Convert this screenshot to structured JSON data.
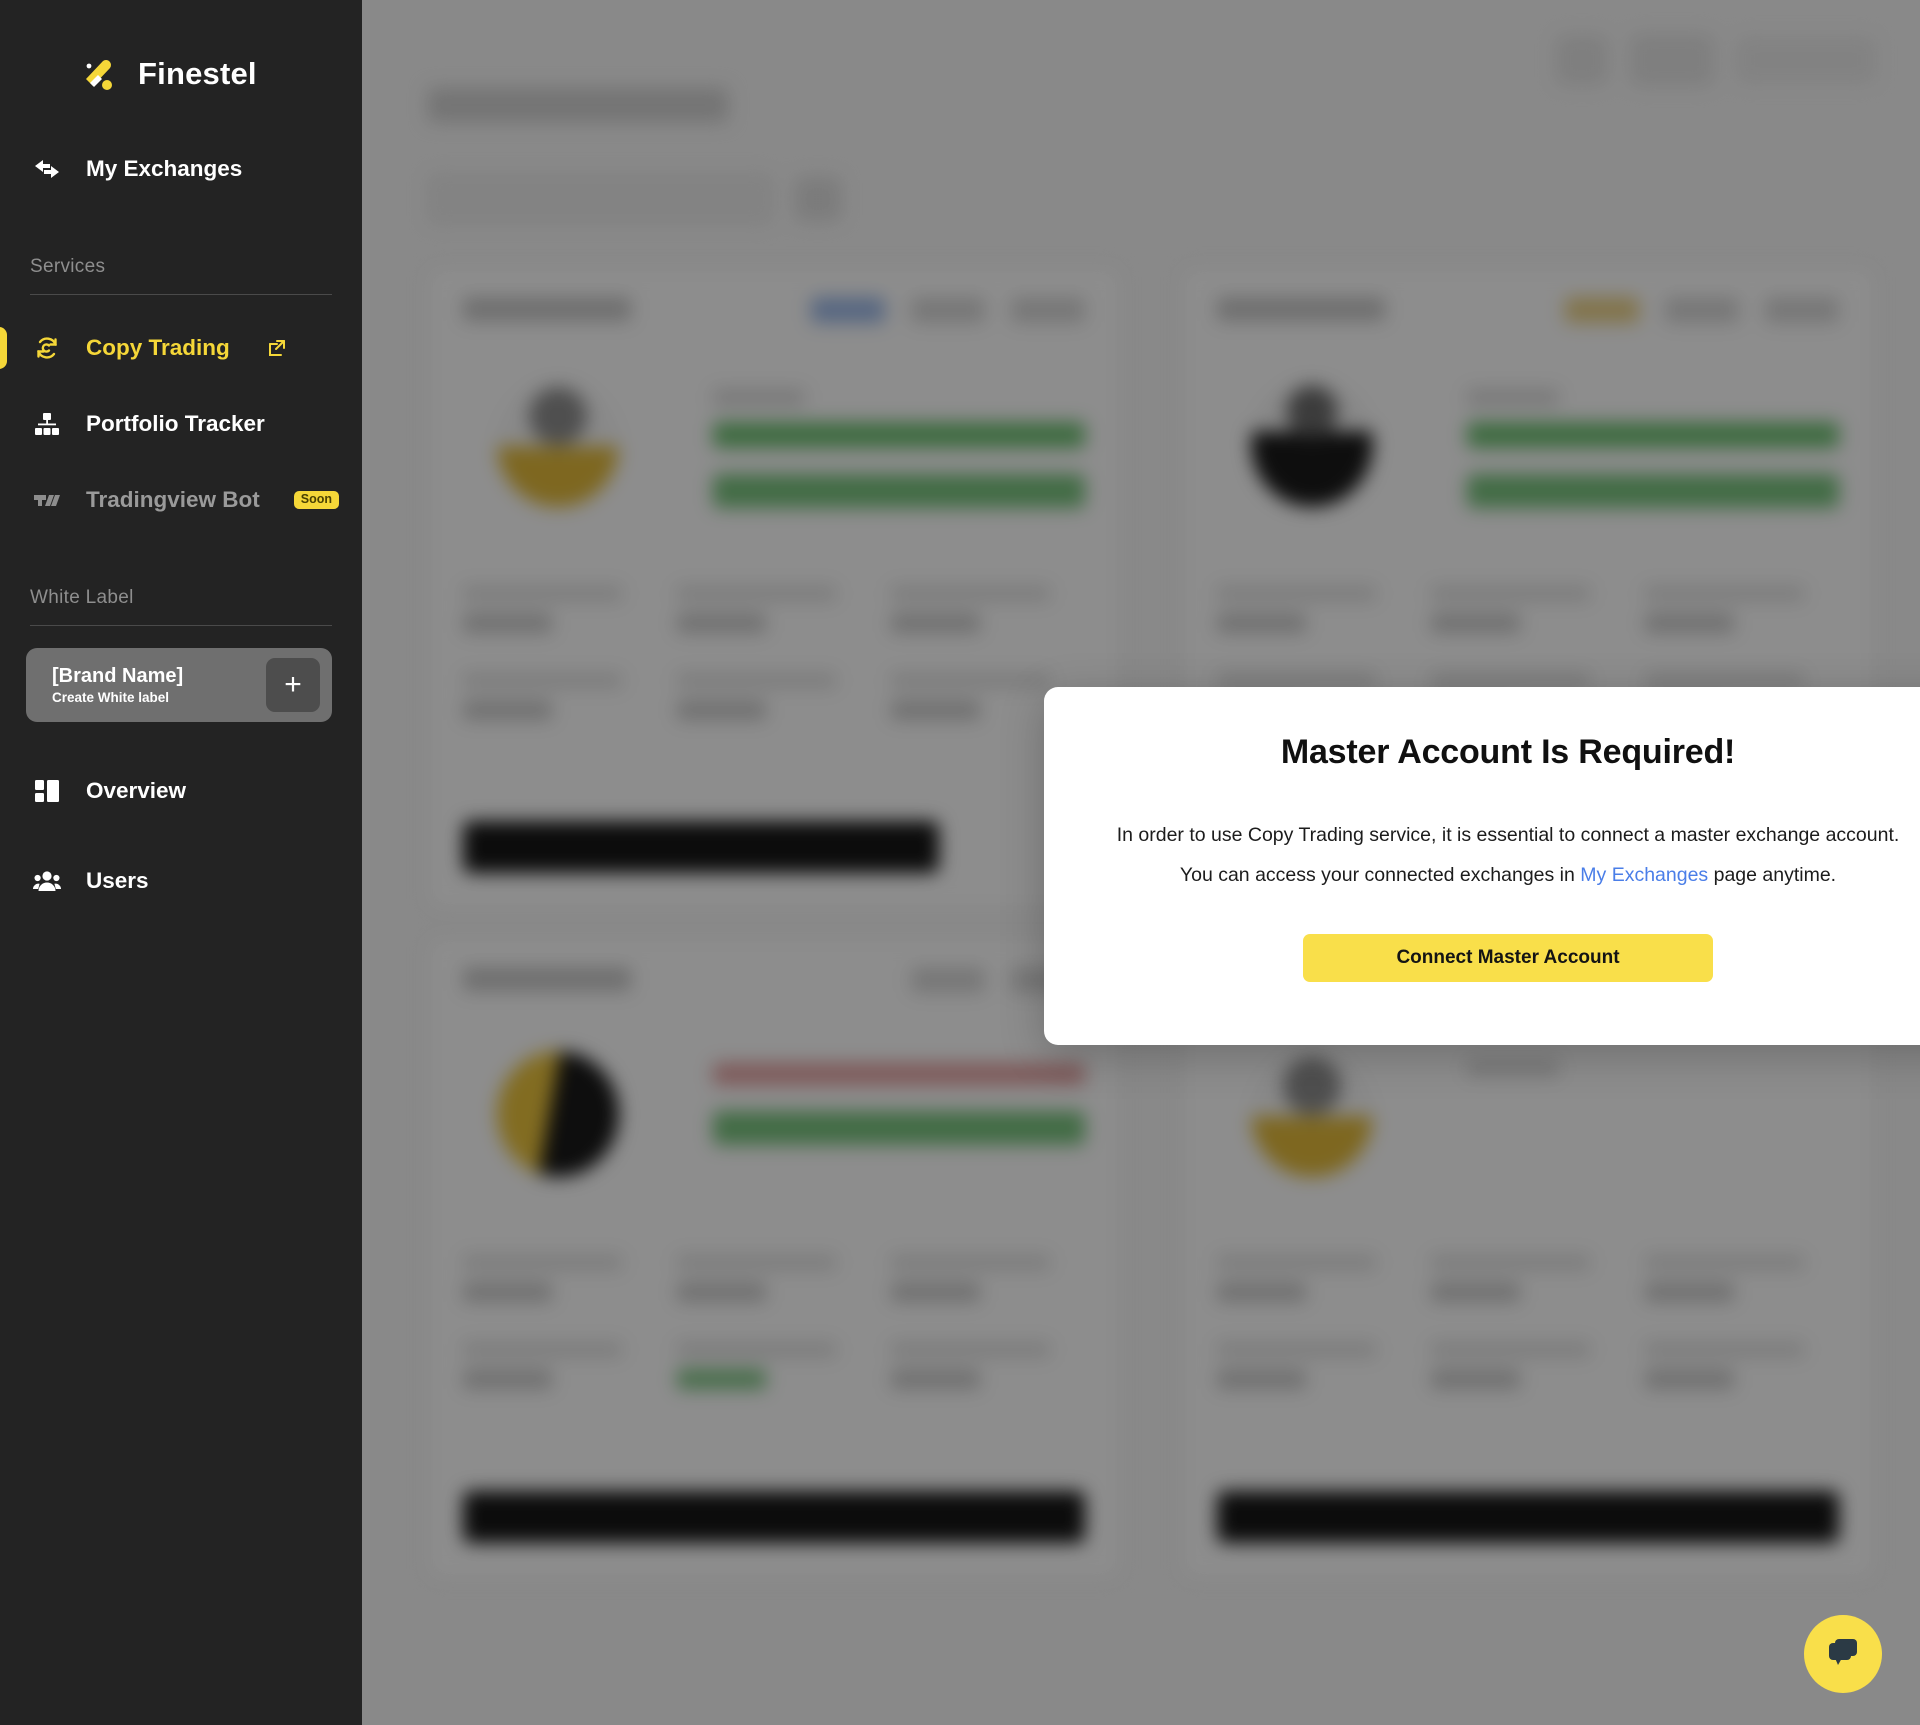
{
  "sidebar": {
    "brand": {
      "name": "Finestel",
      "logo_icon": "finestel-bolt-logo"
    },
    "top_items": [
      {
        "label": "My Exchanges",
        "icon": "exchange-arrows-icon"
      }
    ],
    "sections": [
      {
        "title": "Services",
        "items": [
          {
            "label": "Copy Trading",
            "icon": "copy-trading-refresh-icon",
            "active": true,
            "external_link_icon": "external-link-icon"
          },
          {
            "label": "Portfolio Tracker",
            "icon": "portfolio-tree-icon",
            "active": false
          },
          {
            "label": "Tradingview Bot",
            "icon": "tradingview-icon",
            "active": false,
            "badge": "Soon"
          }
        ]
      },
      {
        "title": "White Label",
        "white_label_card": {
          "brand_name": "[Brand Name]",
          "subtitle": "Create White label",
          "add_icon": "plus-icon"
        },
        "items": [
          {
            "label": "Overview",
            "icon": "overview-grid-icon",
            "active": false
          },
          {
            "label": "Users",
            "icon": "users-group-icon",
            "active": false
          }
        ]
      }
    ]
  },
  "modal": {
    "title": "Master Account Is Required!",
    "body_part1": "In order to use Copy Trading service, it is essential to connect a master exchange account. You can access your connected exchanges in ",
    "link_text": "My Exchanges",
    "body_part2": " page anytime.",
    "cta_label": "Connect Master Account"
  },
  "chat": {
    "icon": "chat-bubble-icon"
  },
  "colors": {
    "accent_yellow": "#f9df4a",
    "sidebar_bg": "#232323",
    "link_blue": "#4a7ee8",
    "modal_bg": "#ffffff",
    "scrim": "rgba(0,0,0,0.44)"
  }
}
